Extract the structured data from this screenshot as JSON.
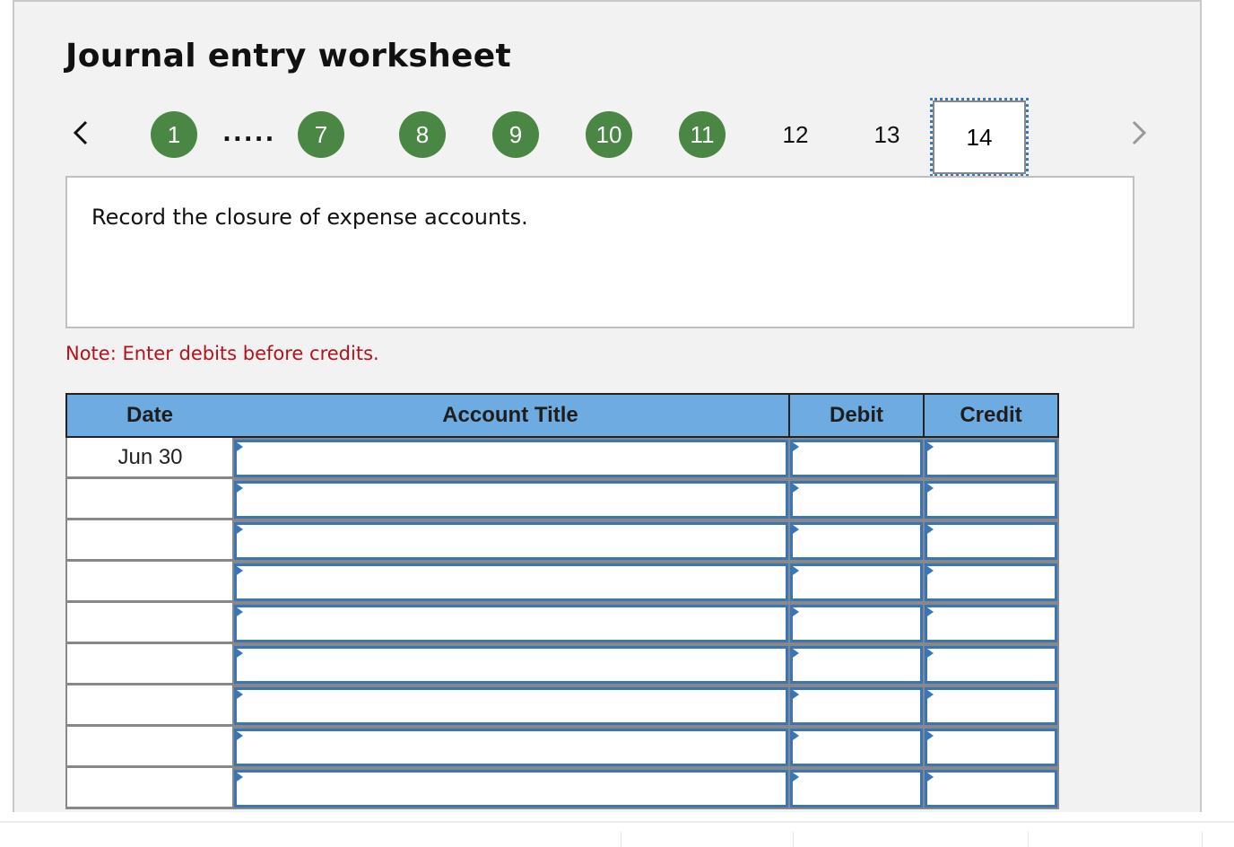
{
  "worksheet": {
    "title": "Journal entry worksheet",
    "nav": {
      "prev_icon": "chevron-left-icon",
      "next_icon": "chevron-right-icon",
      "ellipsis": ".....",
      "steps": [
        {
          "label": "1",
          "state": "completed"
        },
        {
          "label": "7",
          "state": "completed"
        },
        {
          "label": "8",
          "state": "completed"
        },
        {
          "label": "9",
          "state": "completed"
        },
        {
          "label": "10",
          "state": "completed"
        },
        {
          "label": "11",
          "state": "completed"
        },
        {
          "label": "12",
          "state": "pending"
        },
        {
          "label": "13",
          "state": "pending"
        },
        {
          "label": "14",
          "state": "current"
        }
      ]
    },
    "instruction": "Record the closure of expense accounts.",
    "note": "Note: Enter debits before credits.",
    "colors": {
      "completed_step": "#4a8744",
      "header_bg": "#6eabe0",
      "note_text": "#b5121b",
      "input_border": "#3a75b8"
    },
    "table": {
      "headers": {
        "date": "Date",
        "account": "Account Title",
        "debit": "Debit",
        "credit": "Credit"
      },
      "rows": [
        {
          "date": "Jun 30",
          "account": "",
          "debit": "",
          "credit": ""
        },
        {
          "date": "",
          "account": "",
          "debit": "",
          "credit": ""
        },
        {
          "date": "",
          "account": "",
          "debit": "",
          "credit": ""
        },
        {
          "date": "",
          "account": "",
          "debit": "",
          "credit": ""
        },
        {
          "date": "",
          "account": "",
          "debit": "",
          "credit": ""
        },
        {
          "date": "",
          "account": "",
          "debit": "",
          "credit": ""
        },
        {
          "date": "",
          "account": "",
          "debit": "",
          "credit": ""
        },
        {
          "date": "",
          "account": "",
          "debit": "",
          "credit": ""
        },
        {
          "date": "",
          "account": "",
          "debit": "",
          "credit": ""
        }
      ]
    }
  }
}
